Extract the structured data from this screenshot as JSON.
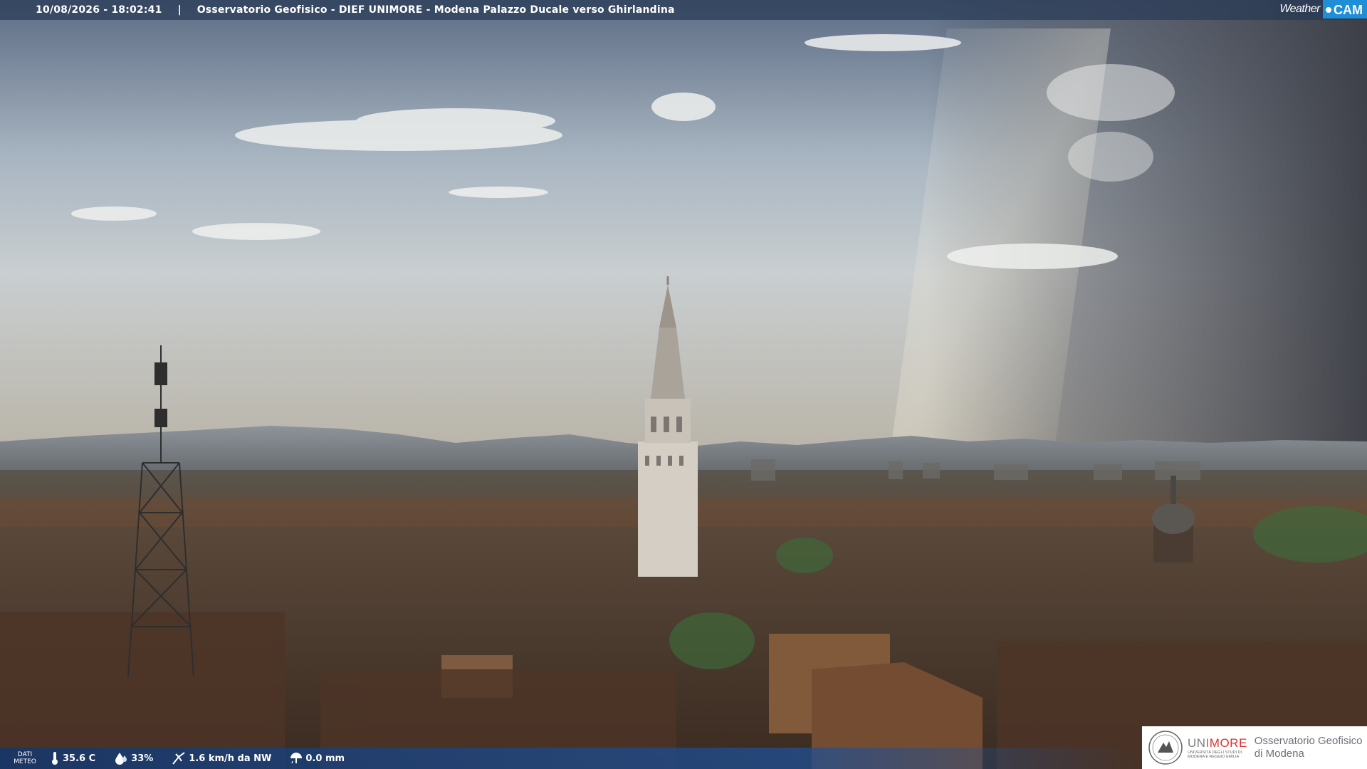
{
  "header": {
    "timestamp": "10/08/2026 - 18:02:41",
    "separator": "|",
    "camera_title": "Osservatorio Geofisico - DIEF UNIMORE - Modena Palazzo Ducale verso Ghirlandina"
  },
  "brand": {
    "logo_left": "Weather",
    "logo_right": "CAM"
  },
  "weather_strip": {
    "label_line1": "DATI",
    "label_line2": "METEO",
    "temperature": "35.6 C",
    "humidity": "33%",
    "wind": "1.6 km/h da NW",
    "rain": "0.0 mm",
    "icons": [
      "thermometer-icon",
      "humidity-drop-icon",
      "wind-icon",
      "rain-icon"
    ]
  },
  "institution": {
    "name_gray": "UNI",
    "name_red": "MORE",
    "name_subtitle": "UNIVERSITÀ DEGLI STUDI DI MODENA E REGGIO EMILIA",
    "observatory_line1": "Osservatorio Geofisico",
    "observatory_line2": "di Modena"
  },
  "colors": {
    "sky_top": "#5a6a82",
    "sky_light": "#c7d0d8",
    "storm": "#4a4c55",
    "city": "#4a3a2e",
    "bar_blue": "#1e3c6e",
    "cam_blue": "#1e8fd6",
    "unimore_red": "#e0312c"
  }
}
